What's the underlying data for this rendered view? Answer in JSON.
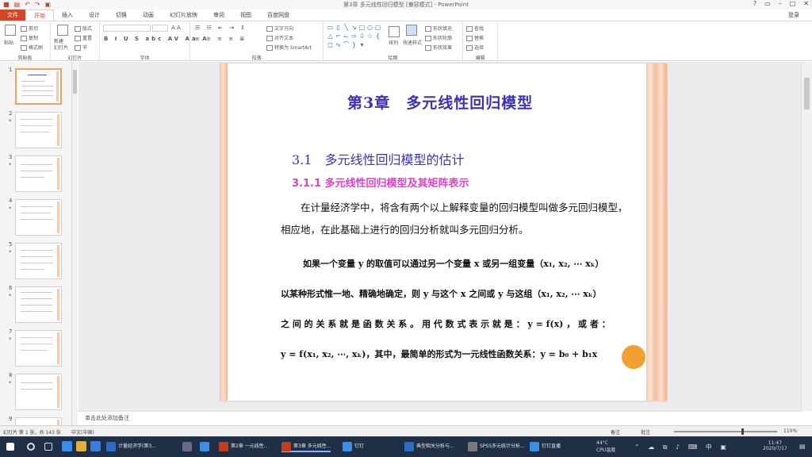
{
  "window": {
    "title": "第3章 多元线性回归模型 [兼容模式] - PowerPoint",
    "login_label": "登录"
  },
  "tabs": [
    {
      "label": "文件"
    },
    {
      "label": "开始"
    },
    {
      "label": "插入"
    },
    {
      "label": "设计"
    },
    {
      "label": "切换"
    },
    {
      "label": "动画"
    },
    {
      "label": "幻灯片放映"
    },
    {
      "label": "审阅"
    },
    {
      "label": "视图"
    },
    {
      "label": "百度网盘"
    }
  ],
  "ribbon": {
    "clipboard": {
      "label": "剪贴板",
      "paste": "粘贴",
      "cut": "剪切",
      "copy": "复制",
      "format_painter": "格式刷"
    },
    "slides": {
      "label": "幻灯片",
      "new_slide": "新建\n幻灯片",
      "layout": "版式",
      "reset": "重置",
      "section": "节"
    },
    "font": {
      "label": "字体"
    },
    "paragraph": {
      "label": "段落",
      "text_direction": "文字方向",
      "align_text": "对齐文本",
      "smartart": "转换为 SmartArt"
    },
    "drawing": {
      "label": "绘图",
      "arrange": "排列",
      "quick_styles": "快速样式",
      "shape_fill": "形状填充",
      "shape_outline": "形状轮廓",
      "shape_effects": "形状效果"
    },
    "editing": {
      "label": "编辑",
      "find": "查找",
      "replace": "替换",
      "select": "选择"
    }
  },
  "slides_panel": [
    {
      "num": "1",
      "star": ""
    },
    {
      "num": "2",
      "star": "*"
    },
    {
      "num": "3",
      "star": "*"
    },
    {
      "num": "4",
      "star": "*"
    },
    {
      "num": "5",
      "star": "*"
    },
    {
      "num": "6",
      "star": "*"
    },
    {
      "num": "7",
      "star": "*"
    },
    {
      "num": "8",
      "star": "*"
    },
    {
      "num": "9",
      "star": ""
    }
  ],
  "slide": {
    "title": "第3章　多元线性回归模型",
    "h1": "3.1　多元线性回归模型的估计",
    "h2": "3.1.1  多元线性回归模型及其矩阵表示",
    "para1": "在计量经济学中，将含有两个以上解释变量的回归模型叫做多元回归模型，相应地，在此基础上进行的回归分析就叫多元回归分析。",
    "line1": "如果一个变量 y 的取值可以通过另一个变量 x 或另一组变量（x₁, x₂, ⋯ xₖ）",
    "line2": "以某种形式惟一地、精确地确定，则 y 与这个 x 之间或 y 与这组（x₁, x₂, ⋯ xₖ）",
    "line3": "之 间 的 关 系 就 是 函 数 关 系 。 用 代 数 式 表 示 就 是 ：  y = f(x) ， 或 者 ：",
    "line4": "y = f(x₁, x₂, ⋯, xₖ)，其中，最简单的形式为一元线性函数关系：y = b₀ + b₁x"
  },
  "notes": {
    "placeholder": "单击此处添加备注"
  },
  "status": {
    "slide_info": "幻灯片 第 1 张，共 143 张",
    "lang": "中文(中国)",
    "notes_btn": "备注",
    "comments_btn": "批注",
    "zoom": "110%",
    "zoom_fraction": 0.66
  },
  "taskbar": {
    "items": [
      {
        "label": "计量经济学(第3...",
        "color": "#2b6cc4"
      },
      {
        "label": "第2章 一元线性...",
        "color": "#c43e1c"
      },
      {
        "label": "第3章 多元线性...",
        "color": "#c43e1c"
      },
      {
        "label": "钉钉",
        "color": "#3a8ee6"
      },
      {
        "label": "典型相关分析与...",
        "color": "#2b6cc4"
      },
      {
        "label": "SPSS多元统计分析...",
        "color": "#7a7a7a"
      },
      {
        "label": "钉钉直播",
        "color": "#3a8ee6"
      }
    ],
    "weather": "44°C",
    "weather_desc": "CPU温度",
    "time": "11:47",
    "date": "2020/7/17"
  },
  "colors": {
    "accent": "#d24726",
    "title_blue": "#3a33b8",
    "subtitle_pink": "#e040c8"
  }
}
